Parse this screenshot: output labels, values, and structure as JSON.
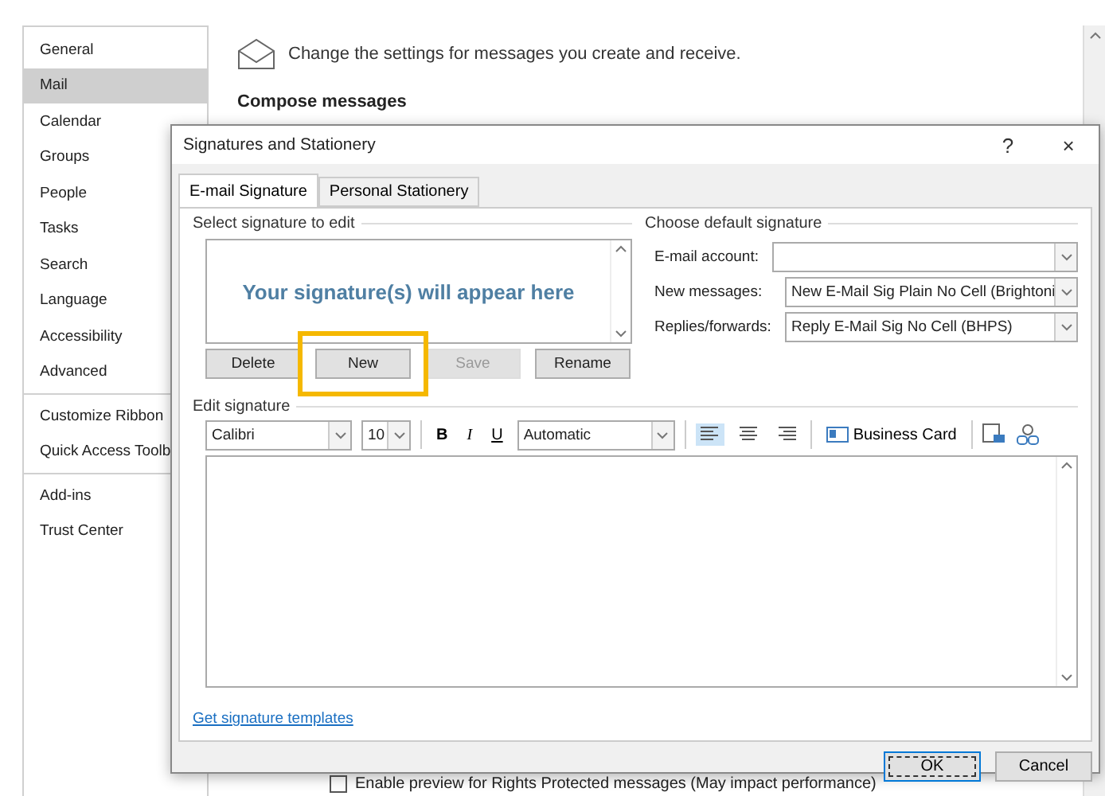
{
  "sidebar": {
    "groups": [
      {
        "items": [
          {
            "label": "General",
            "selected": false
          },
          {
            "label": "Mail",
            "selected": true
          },
          {
            "label": "Calendar",
            "selected": false
          },
          {
            "label": "Groups",
            "selected": false
          },
          {
            "label": "People",
            "selected": false
          },
          {
            "label": "Tasks",
            "selected": false
          },
          {
            "label": "Search",
            "selected": false
          },
          {
            "label": "Language",
            "selected": false
          },
          {
            "label": "Accessibility",
            "selected": false
          },
          {
            "label": "Advanced",
            "selected": false
          }
        ]
      },
      {
        "items": [
          {
            "label": "Customize Ribbon",
            "selected": false
          },
          {
            "label": "Quick Access Toolb",
            "selected": false
          }
        ]
      },
      {
        "items": [
          {
            "label": "Add-ins",
            "selected": false
          },
          {
            "label": "Trust Center",
            "selected": false
          }
        ]
      }
    ]
  },
  "main": {
    "header": "Change the settings for messages you create and receive.",
    "section_title": "Compose messages",
    "checkbox": {
      "label": "Enable preview for Rights Protected messages (May impact performance)",
      "checked": false
    }
  },
  "dialog": {
    "title": "Signatures and Stationery",
    "help": "?",
    "close": "×",
    "tabs": [
      {
        "label": "E-mail Signature",
        "selected": true
      },
      {
        "label": "Personal Stationery",
        "selected": false
      }
    ],
    "select_group": {
      "label": "Select signature to edit",
      "list_text": "Your signature(s) will appear here",
      "buttons": [
        {
          "label": "Delete",
          "disabled": false,
          "highlighted": false
        },
        {
          "label": "New",
          "disabled": false,
          "highlighted": true
        },
        {
          "label": "Save",
          "disabled": true,
          "highlighted": false
        },
        {
          "label": "Rename",
          "disabled": false,
          "highlighted": false
        }
      ]
    },
    "default_group": {
      "label": "Choose default signature",
      "fields": [
        {
          "label": "E-mail account:"
        },
        {
          "label": "New messages:",
          "value": "New E-Mail Sig Plain No Cell (Brightoni"
        },
        {
          "label": "Replies/forwards:",
          "value": "Reply E-Mail Sig No Cell (BHPS)"
        }
      ]
    },
    "edit_group": {
      "label": "Edit signature",
      "font": "Calibri",
      "size": "10",
      "styles": [
        "B",
        "I",
        "U"
      ],
      "shade": "Automatic",
      "alignments": [
        {
          "kind": "left",
          "selected": true
        },
        {
          "kind": "center",
          "selected": false
        },
        {
          "kind": "right",
          "selected": false
        }
      ],
      "business_card": "Business Card"
    },
    "templates_link": "Get signature templates",
    "buttons": [
      {
        "label": "OK",
        "default": true
      },
      {
        "label": "Cancel",
        "default": false
      }
    ]
  }
}
